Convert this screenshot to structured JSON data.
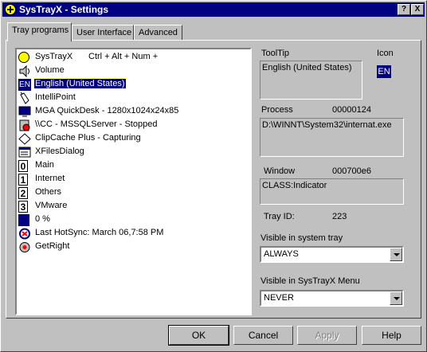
{
  "window": {
    "title": "SysTrayX - Settings",
    "help_btn": "?",
    "close_btn": "X"
  },
  "tabs": [
    {
      "label": "Tray programs"
    },
    {
      "label": "User Interface"
    },
    {
      "label": "Advanced"
    }
  ],
  "tray_list": [
    {
      "label": "SysTrayX",
      "hotkey": "Ctrl + Alt + Num +",
      "icon": "systrayx-icon"
    },
    {
      "label": "Volume",
      "icon": "speaker-icon"
    },
    {
      "label": "English (United States)",
      "icon": "en-language-icon",
      "icon_text": "EN",
      "selected": true
    },
    {
      "label": "IntelliPoint",
      "icon": "mouse-icon"
    },
    {
      "label": "MGA QuickDesk - 1280x1024x24x85",
      "icon": "monitor-icon"
    },
    {
      "label": "\\\\CC - MSSQLServer - Stopped",
      "icon": "sql-server-icon"
    },
    {
      "label": "ClipCache Plus - Capturing",
      "icon": "clipcache-icon"
    },
    {
      "label": "XFilesDialog",
      "icon": "dialog-icon"
    },
    {
      "label": "Main",
      "icon": "desktop-0-icon",
      "icon_text": "0"
    },
    {
      "label": "Internet",
      "icon": "desktop-1-icon",
      "icon_text": "1"
    },
    {
      "label": "Others",
      "icon": "desktop-2-icon",
      "icon_text": "2"
    },
    {
      "label": "VMware",
      "icon": "desktop-3-icon",
      "icon_text": "3"
    },
    {
      "label": "0 %",
      "icon": "cpu-meter-icon"
    },
    {
      "label": "Last HotSync: March 06,7:58 PM",
      "icon": "hotsync-icon"
    },
    {
      "label": "GetRight",
      "icon": "getright-icon"
    }
  ],
  "details": {
    "tooltip_label": "ToolTip",
    "tooltip_value": "English (United States)",
    "icon_label": "Icon",
    "icon_value": "EN",
    "process_label": "Process",
    "process_id": "00000124",
    "process_path": "D:\\WINNT\\System32\\internat.exe",
    "window_label": "Window",
    "window_id": "000700e6",
    "window_class": "CLASS:Indicator",
    "tray_id_label": "Tray ID:",
    "tray_id_value": "223",
    "visible_tray_label": "Visible in system tray",
    "visible_tray_value": "ALWAYS",
    "visible_menu_label": "Visible in SysTrayX Menu",
    "visible_menu_value": "NEVER"
  },
  "buttons": {
    "ok": "OK",
    "cancel": "Cancel",
    "apply": "Apply",
    "help": "Help"
  },
  "colors": {
    "title_bar": "#000080",
    "face": "#c0c0c0",
    "selection": "#000080"
  }
}
